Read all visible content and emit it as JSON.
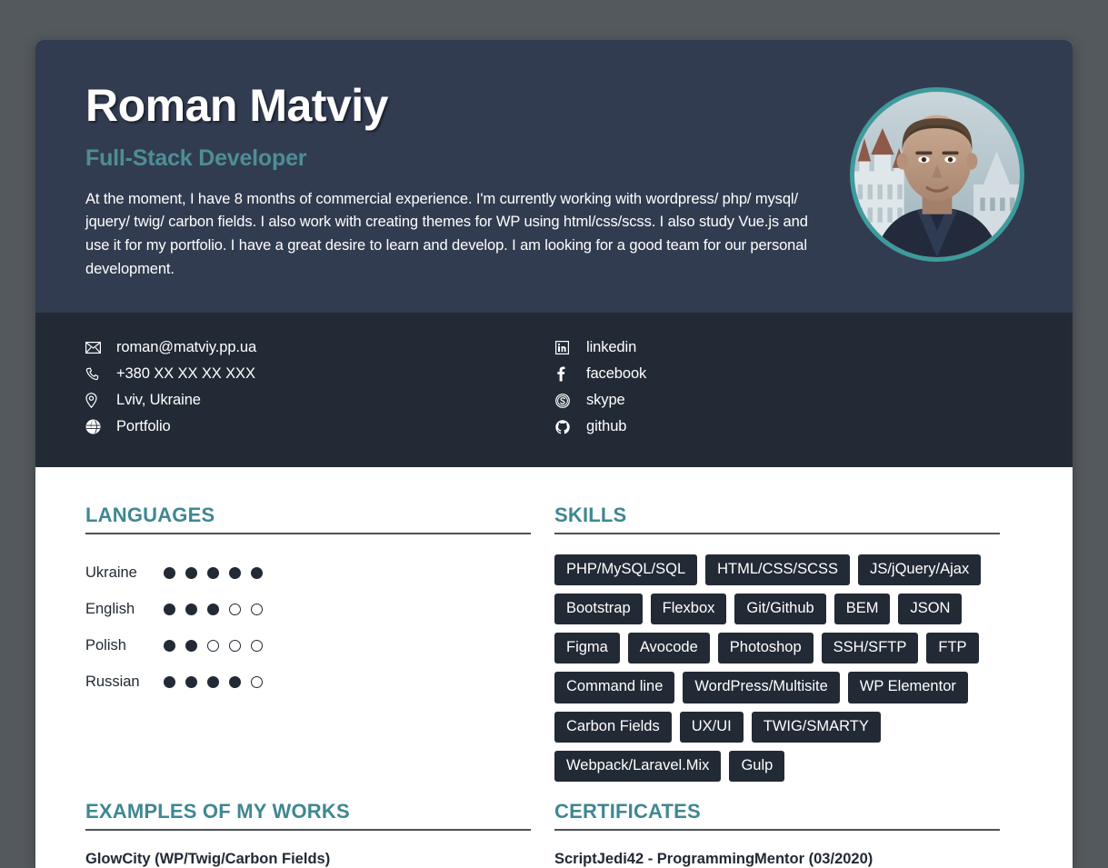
{
  "theme": {
    "page_background": "#54595d",
    "header_background": "#323c51",
    "contact_background": "#222a35",
    "accent_teal": "#3f8793",
    "title_teal": "#4e8e95",
    "avatar_ring": "#3f9a9c",
    "rule_color": "#4d5255",
    "card_background": "#ffffff"
  },
  "header": {
    "full_name": "Roman Matviy",
    "job_title": "Full-Stack Developer",
    "summary": "At the moment, I have 8 months of commercial experience. I'm currently working with wordpress/ php/ mysql/ jquery/ twig/ carbon fields. I also work with creating themes for WP using html/css/scss. I also study Vue.js and use it for my portfolio. I have a great desire to learn and develop. I am looking for a good team for our personal development.",
    "avatar_alt": "portrait-photo"
  },
  "contact": {
    "left": [
      {
        "icon": "envelope-icon",
        "label": "roman@matviy.pp.ua"
      },
      {
        "icon": "phone-icon",
        "label": "+380 XX XX XX XXX"
      },
      {
        "icon": "map-pin-icon",
        "label": "Lviv, Ukraine"
      },
      {
        "icon": "globe-icon",
        "label": "Portfolio"
      }
    ],
    "right": [
      {
        "icon": "linkedin-icon",
        "label": "linkedin"
      },
      {
        "icon": "facebook-icon",
        "label": "facebook"
      },
      {
        "icon": "skype-icon",
        "label": "skype"
      },
      {
        "icon": "github-icon",
        "label": "github"
      }
    ]
  },
  "languages": {
    "heading": "LANGUAGES",
    "max_level": 5,
    "items": [
      {
        "name": "Ukraine",
        "level": 5
      },
      {
        "name": "English",
        "level": 3
      },
      {
        "name": "Polish",
        "level": 2
      },
      {
        "name": "Russian",
        "level": 4
      }
    ]
  },
  "skills": {
    "heading": "SKILLS",
    "items": [
      "PHP/MySQL/SQL",
      "HTML/CSS/SCSS",
      "JS/jQuery/Ajax",
      "Bootstrap",
      "Flexbox",
      "Git/Github",
      "BEM",
      "JSON",
      "Figma",
      "Avocode",
      "Photoshop",
      "SSH/SFTP",
      "FTP",
      "Command line",
      "WordPress/Multisite",
      "WP Elementor",
      "Carbon Fields",
      "UX/UI",
      "TWIG/SMARTY",
      "Webpack/Laravel.Mix",
      "Gulp"
    ]
  },
  "works": {
    "heading": "EXAMPLES OF MY WORKS",
    "items": [
      "GlowCity (WP/Twig/Carbon Fields)"
    ]
  },
  "certificates": {
    "heading": "CERTIFICATES",
    "items": [
      "ScriptJedi42 - ProgrammingMentor (03/2020)"
    ]
  }
}
